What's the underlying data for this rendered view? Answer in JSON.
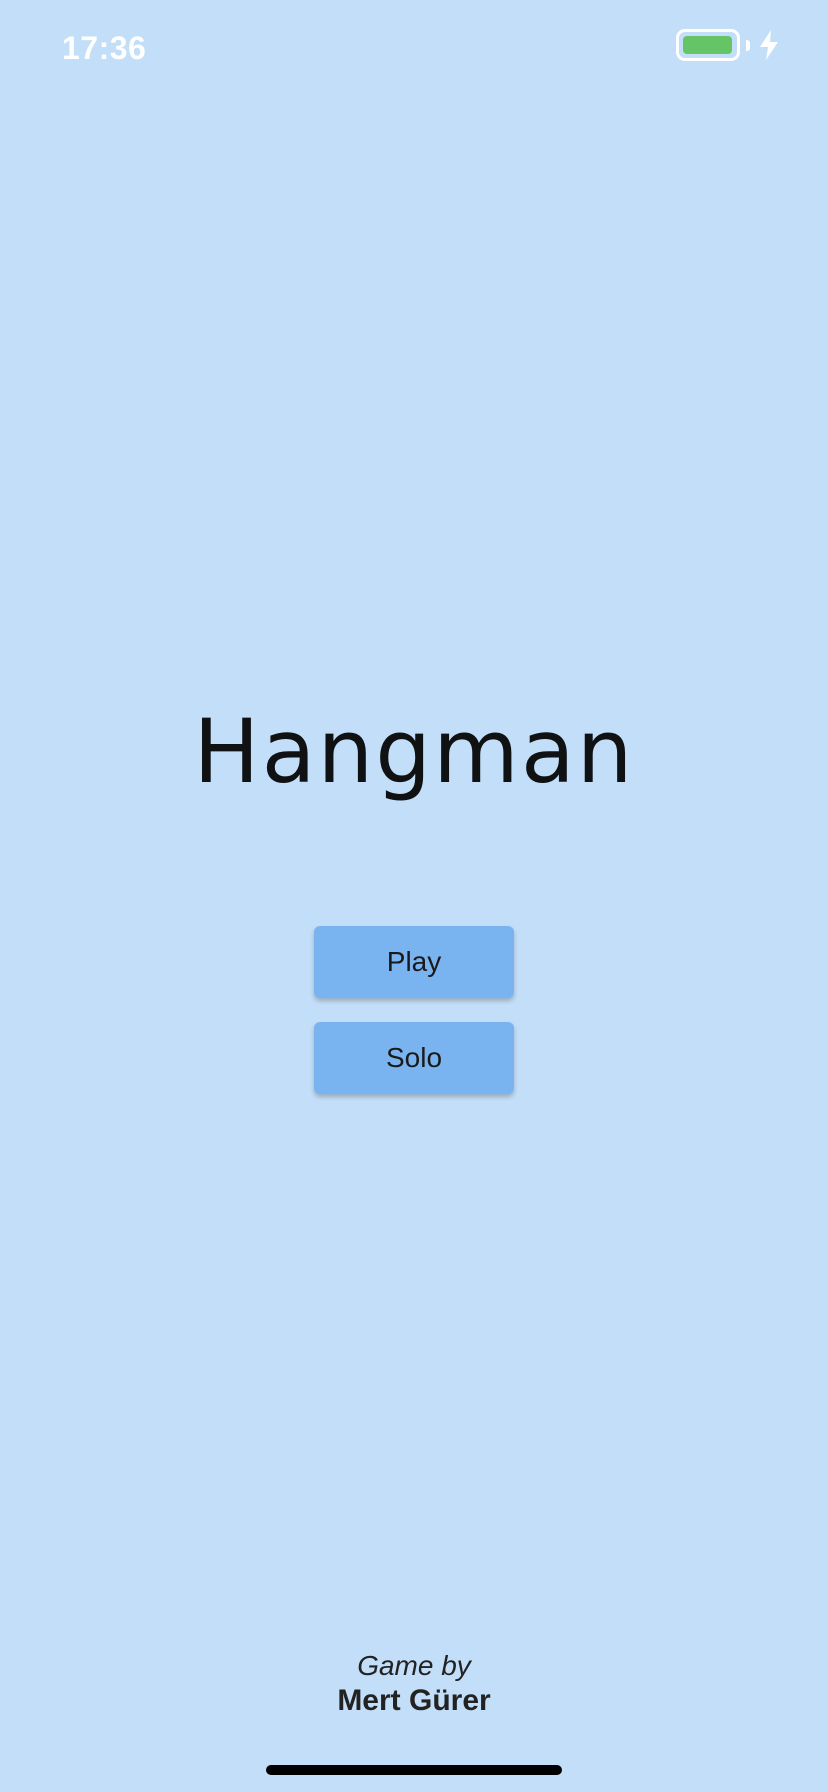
{
  "status_bar": {
    "time": "17:36",
    "battery_level": 1.0,
    "charging": true,
    "battery_icon": "battery-icon",
    "charging_icon": "bolt-icon"
  },
  "main": {
    "title": "Hangman",
    "buttons": {
      "play_label": "Play",
      "solo_label": "Solo"
    }
  },
  "footer": {
    "credit_line": "Game by",
    "author": "Mert Gürer"
  },
  "colors": {
    "background": "#c3def8",
    "button": "#7ab4f0",
    "battery_fill": "#65c466"
  }
}
